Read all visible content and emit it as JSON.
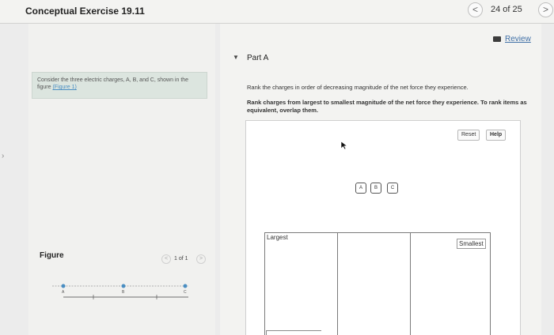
{
  "header": {
    "title": "Conceptual Exercise 19.11",
    "page_count": "24 of 25",
    "prev_glyph": "<",
    "next_glyph": ">"
  },
  "left": {
    "description": "Consider the three electric charges, A, B, and C, shown in the figure ",
    "figure_link": "(Figure 1)",
    "figure_label": "Figure",
    "pager_count": "1 of 1",
    "pager_prev_glyph": "<",
    "pager_next_glyph": ">",
    "figure_letters": [
      "A",
      "B",
      "C"
    ]
  },
  "right": {
    "review_label": "Review",
    "part_caret": "▼",
    "part_title": "Part A",
    "prompt": "Rank the charges in order of decreasing magnitude of the net force they experience.",
    "instructions": "Rank charges from largest to smallest magnitude of the net force they experience. To rank items as equivalent, overlap them.",
    "reset_label": "Reset",
    "help_label": "Help",
    "tiles": [
      "A",
      "B",
      "C"
    ],
    "largest_label": "Largest",
    "smallest_label": "Smallest"
  },
  "icons": {
    "review": "review-icon",
    "cursor": "arrow-cursor-icon",
    "edge": "chevron-right-icon"
  },
  "colors": {
    "link": "#3f6fa6",
    "description_bg": "#dce5df",
    "figure_charge": "#4a8ec2"
  }
}
